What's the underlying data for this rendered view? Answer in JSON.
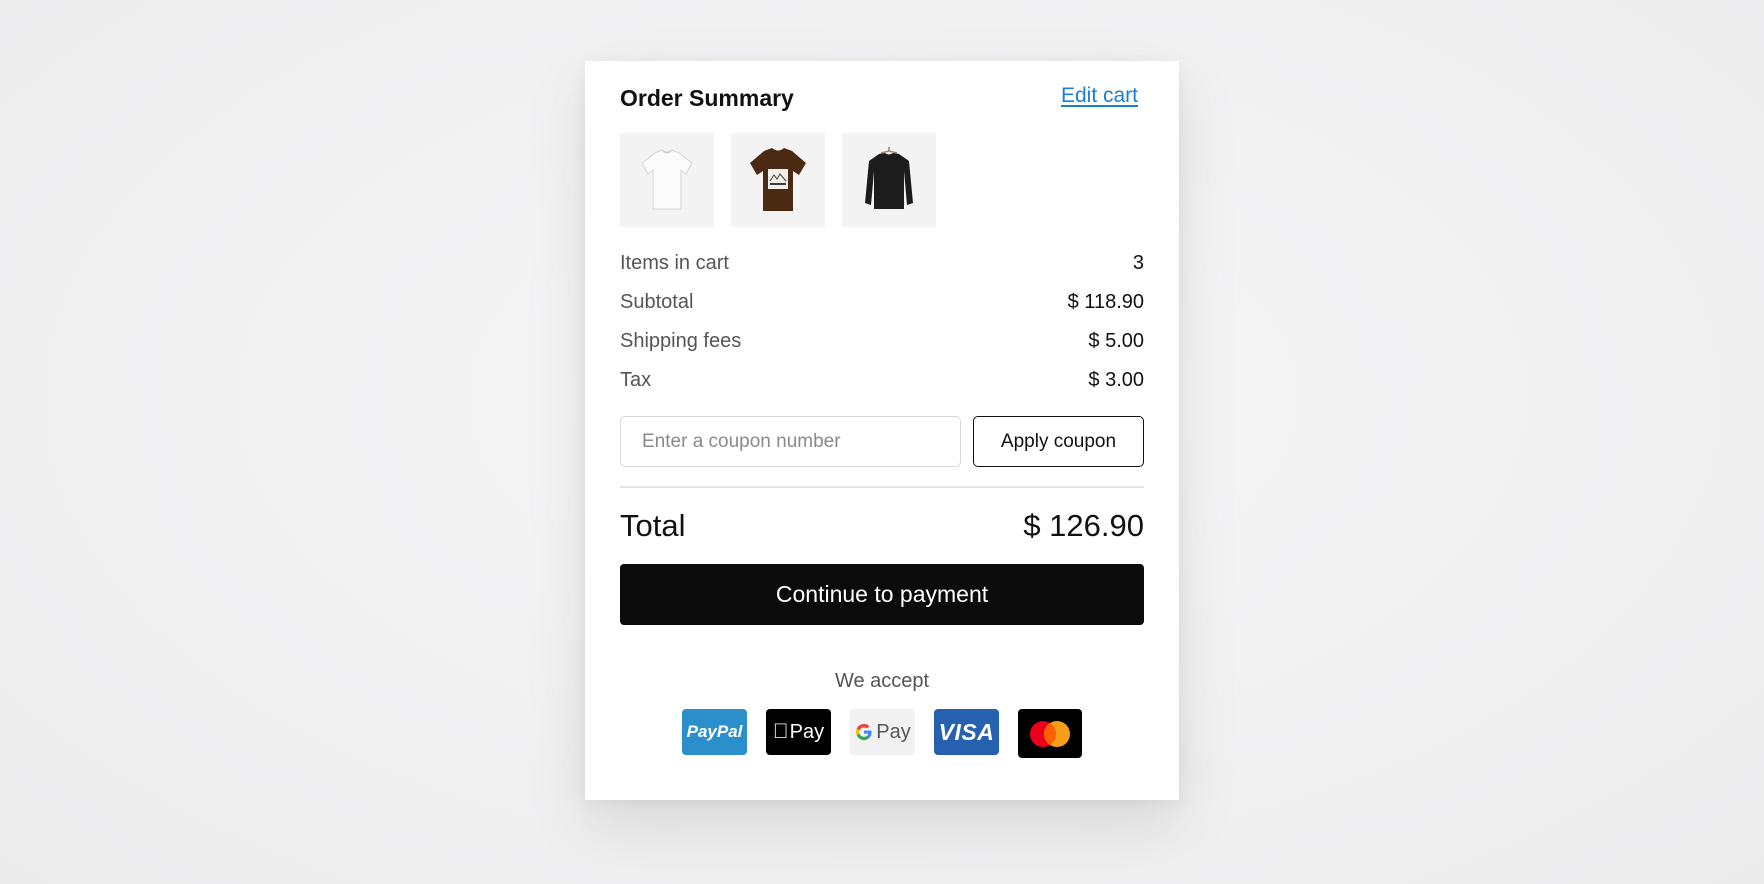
{
  "summary": {
    "title": "Order Summary",
    "edit_label": "Edit cart"
  },
  "products": [
    {
      "name": "white t-shirt",
      "color": "#f2f2f2"
    },
    {
      "name": "brown graphic t-shirt",
      "color": "#4a2a12"
    },
    {
      "name": "black sweatshirt",
      "color": "#1c1c1c"
    }
  ],
  "rows": [
    {
      "label": "Items in cart",
      "value": "3"
    },
    {
      "label": "Subtotal",
      "value": "$ 118.90"
    },
    {
      "label": "Shipping fees",
      "value": "$ 5.00"
    },
    {
      "label": "Tax",
      "value": "$ 3.00"
    }
  ],
  "coupon": {
    "placeholder": "Enter a coupon number",
    "value": "",
    "apply_label": "Apply coupon"
  },
  "total": {
    "label": "Total",
    "value": "$ 126.90"
  },
  "payment_button": "Continue to payment",
  "accept_label": "We accept",
  "payment_methods": {
    "paypal": "PayPal",
    "apple_pay": "Pay",
    "google_pay": "Pay",
    "visa": "VISA",
    "mastercard": "Mastercard"
  },
  "colors": {
    "link": "#1a7fd4",
    "primary_button": "#0b0b0b",
    "paypal": "#2a8fcb",
    "visa": "#2561ae"
  }
}
